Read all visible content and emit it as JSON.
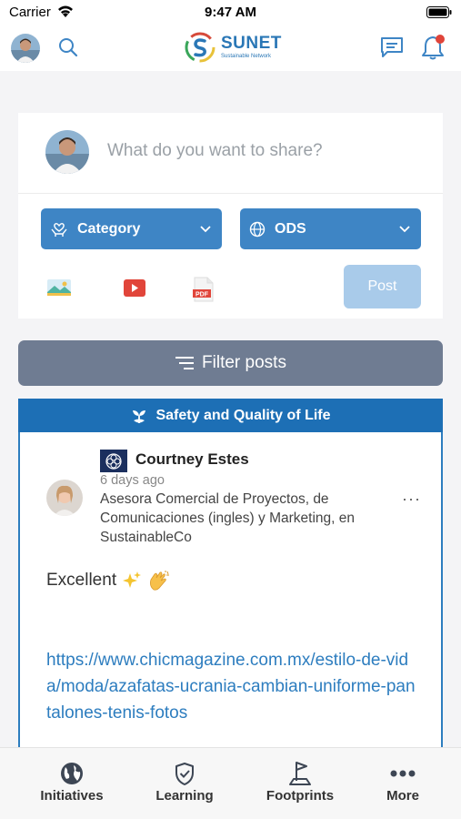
{
  "status_bar": {
    "carrier": "Carrier",
    "time": "9:47 AM"
  },
  "header": {
    "logo_title": "SUNET",
    "logo_subtitle": "Sustainable Network",
    "icons": [
      "avatar",
      "search-icon",
      "chat-icon",
      "bell-icon"
    ],
    "notification_dot_color": "#e0443a"
  },
  "composer": {
    "placeholder": "What do you want to share?",
    "category_label": "Category",
    "ods_label": "ODS",
    "post_label": "Post",
    "attachments": [
      "image-icon",
      "video-icon",
      "pdf-icon"
    ],
    "pdf_badge": "PDF"
  },
  "filter": {
    "label": "Filter posts"
  },
  "post": {
    "category_banner": "Safety and Quality of Life",
    "author": "Courtney Estes",
    "time": "6 days ago",
    "role": "Asesora Comercial de Proyectos, de Comunicaciones (ingles) y Marketing, en SustainableCo",
    "more": "···",
    "text": "Excellent",
    "emojis": [
      "sparkles-icon",
      "clapping-hands-icon"
    ],
    "link": "https://www.chicmagazine.com.mx/estilo-de-vida/moda/azafatas-ucrania-cambian-uniforme-pantalones-tenis-fotos"
  },
  "bottom_nav": {
    "items": [
      {
        "label": "Initiatives",
        "icon": "globe-icon"
      },
      {
        "label": "Learning",
        "icon": "shield-check-icon"
      },
      {
        "label": "Footprints",
        "icon": "flag-icon"
      },
      {
        "label": "More",
        "icon": "more-dots-icon"
      }
    ]
  },
  "colors": {
    "primary": "#3e85c5",
    "banner": "#1d6fb5",
    "filter": "#6f7c92",
    "post_disabled": "#a9cbea",
    "link": "#2d7dbf"
  }
}
